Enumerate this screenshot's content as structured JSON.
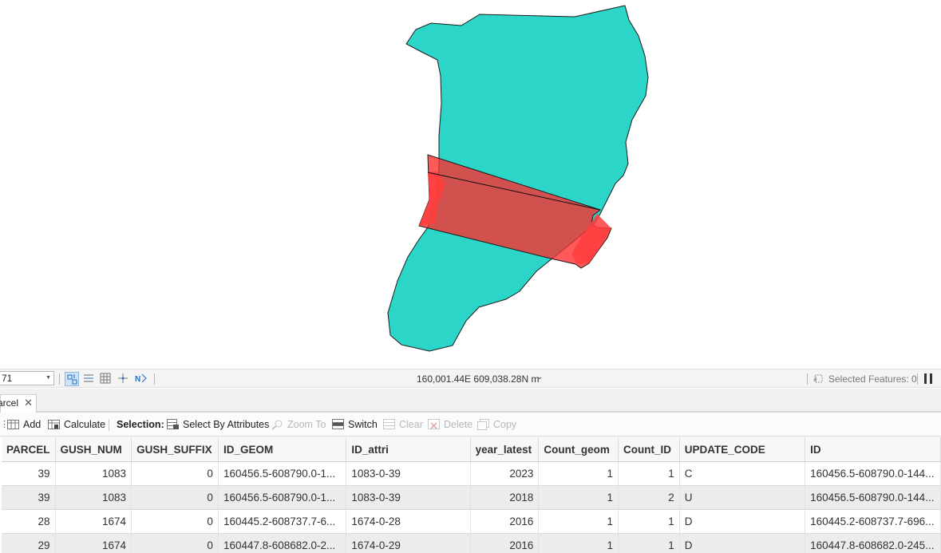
{
  "statusbar": {
    "scale_value": "71",
    "coordinates": "160,001.44E 609,038.28N m",
    "selected_features": "Selected Features: 0"
  },
  "tab": {
    "label": "arcel"
  },
  "toolbar": {
    "add": "Add",
    "calculate": "Calculate",
    "selection_label": "Selection:",
    "select_by_attributes": "Select By Attributes",
    "zoom_to": "Zoom To",
    "switch": "Switch",
    "clear": "Clear",
    "delete": "Delete",
    "copy": "Copy"
  },
  "table": {
    "columns": [
      "PARCEL",
      "GUSH_NUM",
      "GUSH_SUFFIX",
      "ID_GEOM",
      "ID_attri",
      "year_latest",
      "Count_geom",
      "Count_ID",
      "UPDATE_CODE",
      "ID"
    ],
    "rows": [
      [
        "39",
        "1083",
        "0",
        "160456.5-608790.0-1...",
        "1083-0-39",
        "2023",
        "1",
        "1",
        "C",
        "160456.5-608790.0-144..."
      ],
      [
        "39",
        "1083",
        "0",
        "160456.5-608790.0-1...",
        "1083-0-39",
        "2018",
        "1",
        "2",
        "U",
        "160456.5-608790.0-144..."
      ],
      [
        "28",
        "1674",
        "0",
        "160445.2-608737.7-6...",
        "1674-0-28",
        "2016",
        "1",
        "1",
        "D",
        "160445.2-608737.7-696..."
      ],
      [
        "29",
        "1674",
        "0",
        "160447.8-608682.0-2...",
        "1674-0-29",
        "2016",
        "1",
        "1",
        "D",
        "160447.8-608682.0-245..."
      ]
    ]
  },
  "colors": {
    "parcel_fill": "#2bd6c8",
    "overlay_fill": "#f03838"
  }
}
